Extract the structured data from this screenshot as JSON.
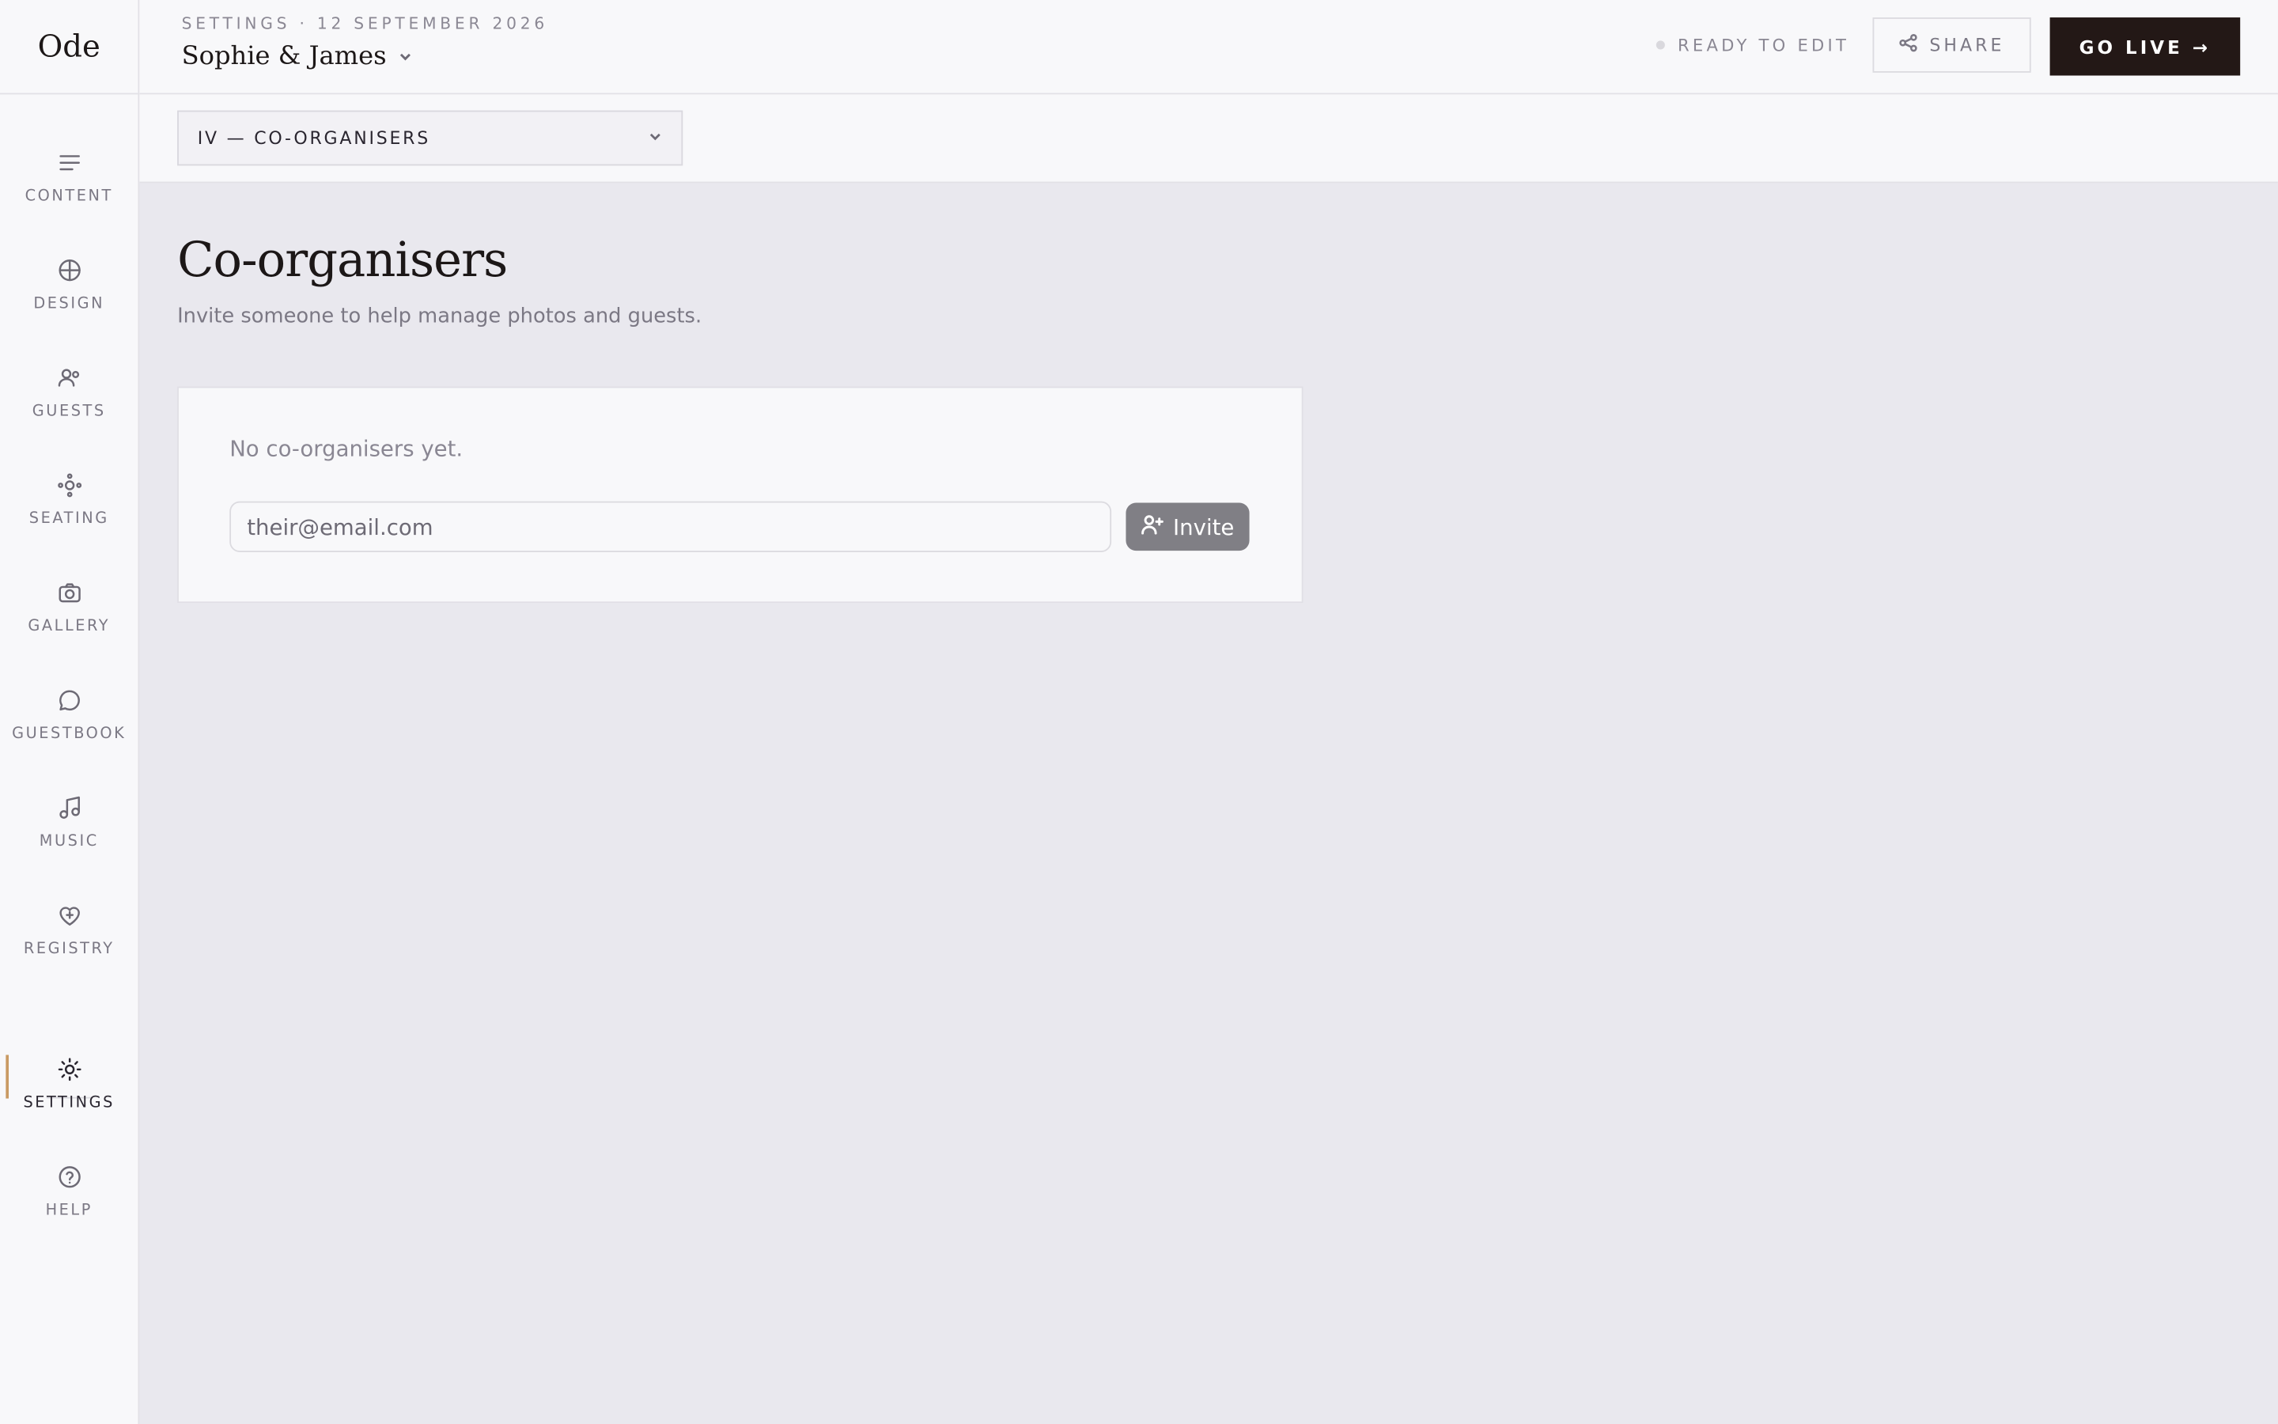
{
  "app": {
    "logo": "Ode"
  },
  "header": {
    "breadcrumb": "SETTINGS · 12 SEPTEMBER 2026",
    "project_name": "Sophie & James",
    "status_label": "READY TO EDIT",
    "share_label": "SHARE",
    "go_live_label": "GO LIVE →"
  },
  "sidebar": {
    "items": [
      {
        "label": "CONTENT",
        "icon": "lines-icon"
      },
      {
        "label": "DESIGN",
        "icon": "compass-icon"
      },
      {
        "label": "GUESTS",
        "icon": "users-icon"
      },
      {
        "label": "SEATING",
        "icon": "nodes-icon"
      },
      {
        "label": "GALLERY",
        "icon": "camera-icon"
      },
      {
        "label": "GUESTBOOK",
        "icon": "chat-bubble-icon"
      },
      {
        "label": "MUSIC",
        "icon": "music-note-icon"
      },
      {
        "label": "REGISTRY",
        "icon": "heart-plus-icon"
      },
      {
        "label": "SETTINGS",
        "icon": "gear-icon",
        "active": true
      },
      {
        "label": "HELP",
        "icon": "help-circle-icon"
      }
    ]
  },
  "section_selector": {
    "value": "IV — CO-ORGANISERS"
  },
  "main": {
    "title": "Co-organisers",
    "subtitle": "Invite someone to help manage photos and guests.",
    "empty_text": "No co-organisers yet.",
    "email_placeholder": "their@email.com",
    "invite_label": "Invite"
  },
  "colors": {
    "accent": "#c99a63",
    "primary_button": "#231816",
    "invite_button": "#807f85",
    "canvas": "#e9e8ee"
  }
}
